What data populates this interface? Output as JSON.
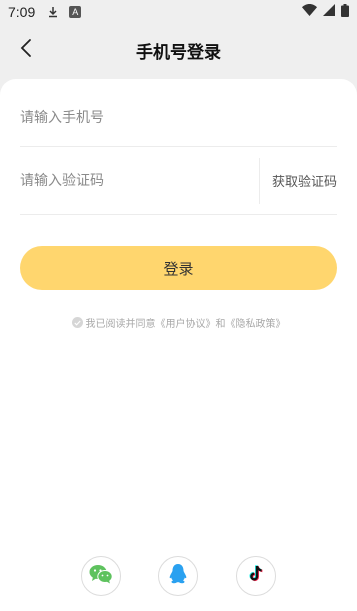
{
  "status_bar": {
    "time": "7:09",
    "icons": [
      "download-icon",
      "font-a-icon",
      "wifi-icon",
      "signal-icon",
      "battery-icon"
    ],
    "font_badge": "A"
  },
  "header": {
    "title": "手机号登录",
    "back_icon": "chevron-left-icon"
  },
  "form": {
    "phone_placeholder": "请输入手机号",
    "code_placeholder": "请输入验证码",
    "get_code_label": "获取验证码",
    "login_label": "登录"
  },
  "agreement": {
    "prefix": "我已阅读并同意",
    "user_agreement": "《用户协议》",
    "and": "和",
    "privacy_policy": "《隐私政策》"
  },
  "social_login": {
    "icons": [
      "wechat-icon",
      "qq-icon",
      "douyin-icon"
    ]
  },
  "colors": {
    "accent": "#ffd66e",
    "background": "#efefef",
    "card": "#ffffff"
  }
}
